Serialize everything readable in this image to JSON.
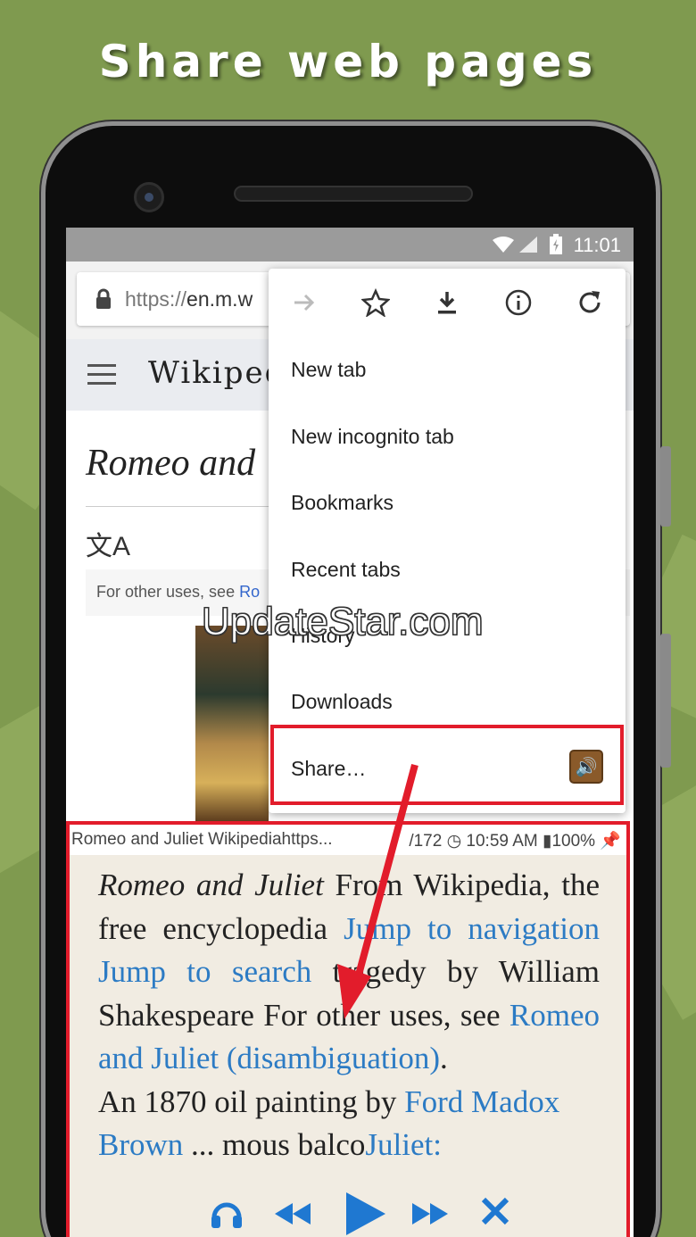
{
  "headline": "Share web pages",
  "status_bar": {
    "time": "11:01"
  },
  "browser": {
    "url_scheme": "https://",
    "url_rest": "en.m.w",
    "wiki_title": "Wikiped",
    "article_title": "Romeo and",
    "hatnote_text": "For other uses, see ",
    "hatnote_link": "Ro"
  },
  "menu": {
    "icons": [
      "forward-icon",
      "star-icon",
      "download-icon",
      "info-icon",
      "refresh-icon"
    ],
    "items": [
      "New tab",
      "New incognito tab",
      "Bookmarks",
      "Recent tabs",
      "History",
      "Downloads",
      "Share…"
    ]
  },
  "watermark": "UpdateStar.com",
  "reader": {
    "status_left": "Romeo and Juliet Wikipediahttps...",
    "status_right": "/172 ◷ 10:59 AM ▮100%",
    "p1": {
      "t1": "Romeo and Juliet",
      "t2": " From Wikipedia, the free encyclopedia ",
      "l1": "Jump to navigation Jump to search",
      "t3": " tragedy by William Shakespeare For other uses, see ",
      "l2": "Romeo and Juliet (disambiguation)",
      "t4": "."
    },
    "p2": {
      "t1": "An 1870 oil painting by ",
      "l1": "Ford Madox Brown",
      "t2": " ... mous balco",
      "l2": "Juliet:"
    }
  },
  "colors": {
    "accent_red": "#e21c2b",
    "link_blue": "#2c7bc4",
    "player_blue": "#1f78d1",
    "background_green": "#7f9a4f"
  }
}
